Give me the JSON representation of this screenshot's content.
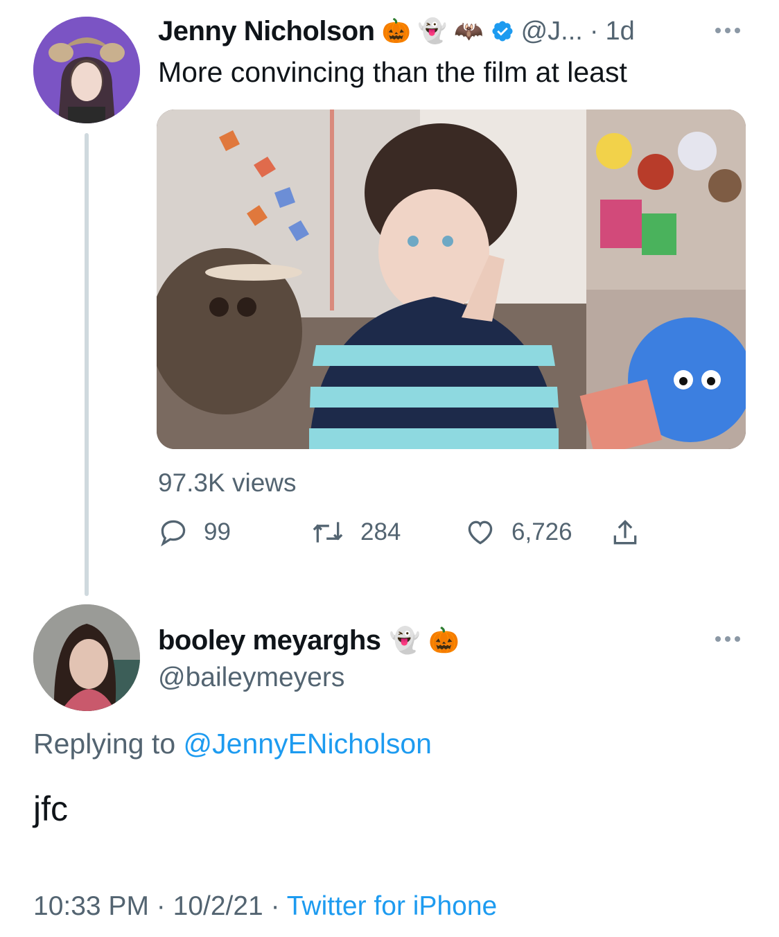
{
  "tweet": {
    "author_name": "Jenny Nicholson",
    "emoji": [
      "🎃",
      "👻",
      "🦇"
    ],
    "handle_truncated": "@J...",
    "separator": "·",
    "age": "1d",
    "text": "More convincing than the film at least",
    "views": "97.3K views",
    "actions": {
      "replies": "99",
      "retweets": "284",
      "likes": "6,726"
    }
  },
  "reply": {
    "author_name": "booley meyarghs",
    "emoji": [
      "👻",
      "🎃"
    ],
    "handle": "@baileymeyers",
    "replying_prefix": "Replying to",
    "replying_handle": "@JennyENicholson",
    "text": "jfc",
    "time": "10:33 PM",
    "dot": "·",
    "date": "10/2/21",
    "source": "Twitter for iPhone"
  },
  "colors": {
    "link": "#1d9bf0",
    "muted": "#536471",
    "verified": "#1d9bf0",
    "thread_line": "#cfd9de"
  },
  "icons": [
    "reply-icon",
    "retweet-icon",
    "like-icon",
    "share-icon",
    "verified-badge-icon",
    "more-options-icon"
  ]
}
